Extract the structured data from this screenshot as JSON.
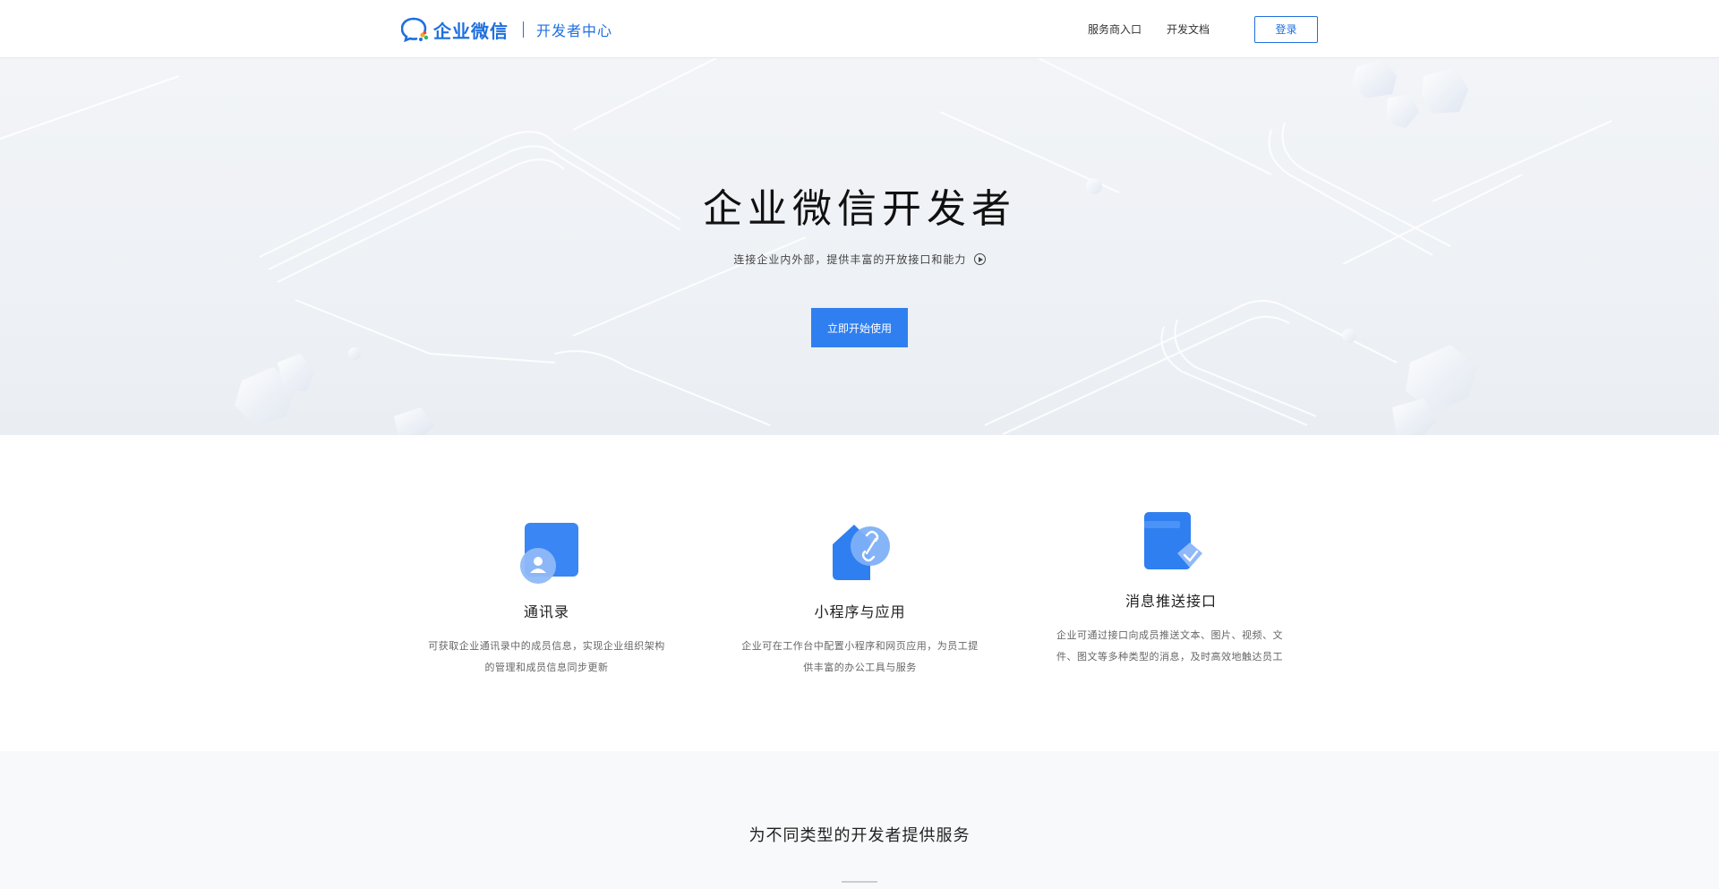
{
  "header": {
    "brand_name": "企业微信",
    "brand_sub": "开发者中心",
    "nav": [
      {
        "label": "服务商入口"
      },
      {
        "label": "开发文档"
      }
    ],
    "login_label": "登录"
  },
  "hero": {
    "title": "企业微信开发者",
    "subtitle": "连接企业内外部，提供丰富的开放接口和能力",
    "cta_label": "立即开始使用"
  },
  "features": [
    {
      "title": "通讯录",
      "desc": "可获取企业通讯录中的成员信息，实现企业组织架构的管理和成员信息同步更新"
    },
    {
      "title": "小程序与应用",
      "desc": "企业可在工作台中配置小程序和网页应用，为员工提供丰富的办公工具与服务"
    },
    {
      "title": "消息推送接口",
      "desc": "企业可通过接口向成员推送文本、图片、视频、文件、图文等多种类型的消息，及时高效地触达"
    }
  ],
  "feature_desc_tail": "员工",
  "bottom": {
    "title": "为不同类型的开发者提供服务"
  },
  "colors": {
    "brand": "#1f6fe0",
    "cta": "#2f7ff0"
  },
  "icons": [
    "logo-chat-icon",
    "contacts-icon",
    "mini-program-icon",
    "message-icon",
    "play-icon"
  ]
}
